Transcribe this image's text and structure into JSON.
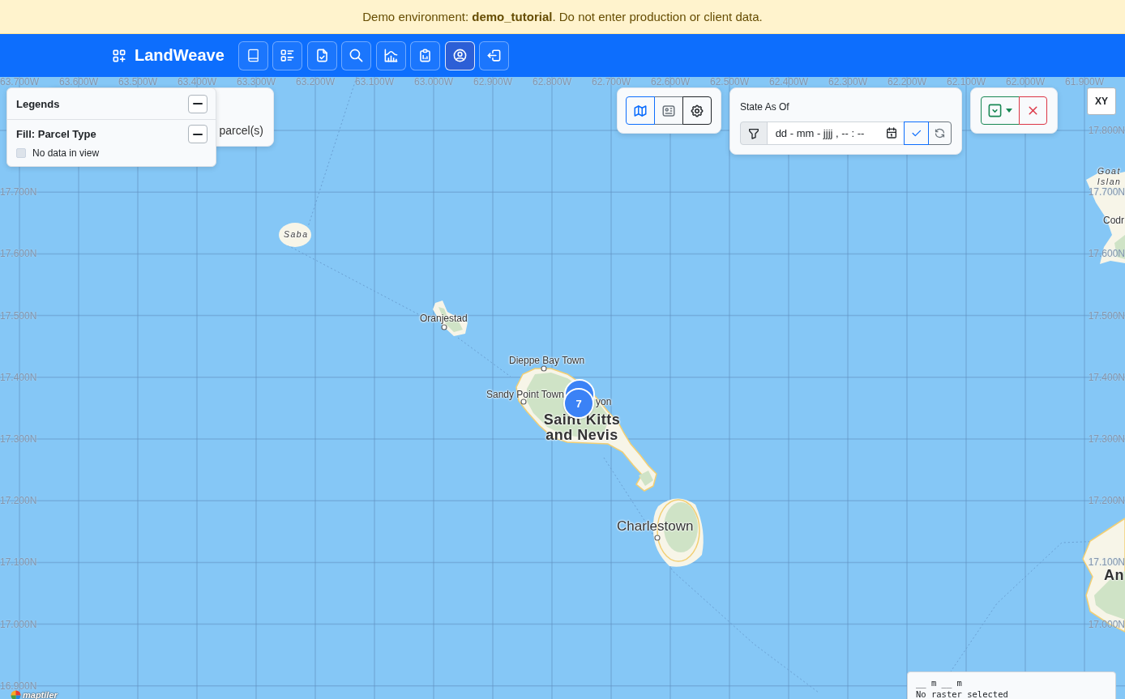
{
  "banner": {
    "text": "Demo environment: **demo_tutorial**. Do not enter production or client data."
  },
  "navbar": {
    "brand": "LandWeave",
    "tools": [
      {
        "selected": false
      },
      {
        "selected": false
      },
      {
        "selected": false
      },
      {
        "selected": false
      },
      {
        "selected": false
      },
      {
        "selected": false
      },
      {
        "selected": true
      },
      {
        "selected": false
      }
    ]
  },
  "map": {
    "longitude_labels": [
      "63.700W",
      "63.600W",
      "63.500W",
      "63.400W",
      "63.300W",
      "63.200W",
      "63.100W",
      "63.000W",
      "62.900W",
      "62.800W",
      "62.700W",
      "62.600W",
      "62.500W",
      "62.400W",
      "62.300W",
      "62.200W",
      "62.100W",
      "62.000W",
      "61.900W"
    ],
    "latitude_labels_left": [
      "17.700N",
      "17.600N",
      "17.500N",
      "17.400N",
      "17.300N",
      "17.200N",
      "17.100N",
      "17.000N",
      "16.900N"
    ],
    "latitude_labels_right": [
      "17.800N",
      "17.700N",
      "17.600N",
      "17.500N",
      "17.400N",
      "17.300N",
      "17.200N",
      "17.100N",
      "17.000N"
    ],
    "place_labels": [
      {
        "text": "Saba",
        "kind": "island"
      },
      {
        "text": "Oranjestad",
        "kind": "town"
      },
      {
        "text": "Dieppe Bay Town",
        "kind": "town"
      },
      {
        "text": "Sandy Point Town",
        "kind": "town"
      },
      {
        "text": "yon",
        "kind": "town"
      },
      {
        "text": "Saint Kitts and Nevis",
        "kind": "country"
      },
      {
        "text": "Charlestown",
        "kind": "city"
      },
      {
        "text": "Goat Islan",
        "kind": "island"
      },
      {
        "text": "Codr",
        "kind": "town"
      },
      {
        "text": "An",
        "kind": "country"
      }
    ],
    "cluster": {
      "count": "7"
    },
    "attribution": "maptiler"
  },
  "map_summary_panel": {
    "text": "parcel(s)"
  },
  "legend": {
    "title": "Legends",
    "expanded": true,
    "sections": [
      {
        "title": "Fill: Parcel Type",
        "expanded": true,
        "items": [
          {
            "label": "No data in view",
            "color": "#dde3ea"
          }
        ]
      }
    ]
  },
  "view_toggle": {
    "buttons": [
      {
        "selected": true
      },
      {
        "selected": false
      }
    ]
  },
  "state_as_of": {
    "label": "State As Of",
    "date_field": {
      "placeholder": "dd - mm - jjjj , -- : --"
    }
  },
  "xy_button": {
    "label": "XY"
  },
  "scale_panel": {
    "scale": "__ m __ m",
    "raster": "No raster selected"
  }
}
